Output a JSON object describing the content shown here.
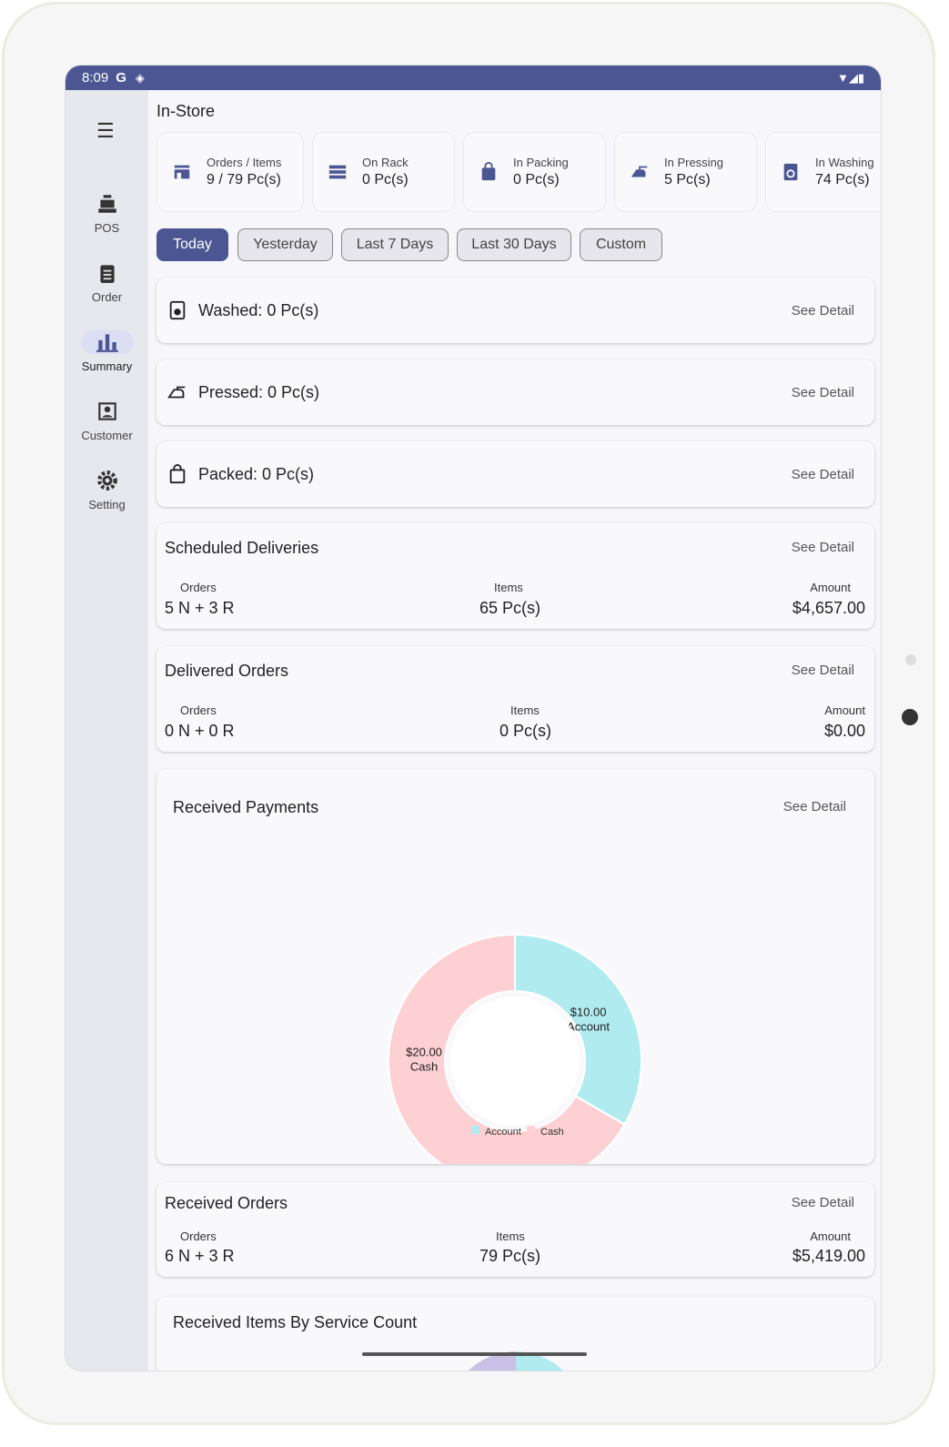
{
  "status": {
    "time": "8:09",
    "g": "G"
  },
  "sidebar": [
    {
      "label": "POS"
    },
    {
      "label": "Order"
    },
    {
      "label": "Summary"
    },
    {
      "label": "Customer"
    },
    {
      "label": "Setting"
    }
  ],
  "title": "In-Store",
  "stats": [
    {
      "label": "Orders / Items",
      "value": "9 / 79 Pc(s)"
    },
    {
      "label": "On Rack",
      "value": "0 Pc(s)"
    },
    {
      "label": "In Packing",
      "value": "0 Pc(s)"
    },
    {
      "label": "In Pressing",
      "value": "5 Pc(s)"
    },
    {
      "label": "In Washing",
      "value": "74 Pc(s)"
    }
  ],
  "filters": [
    "Today",
    "Yesterday",
    "Last 7 Days",
    "Last 30 Days",
    "Custom"
  ],
  "see_detail": "See Detail",
  "simple": [
    {
      "label": "Washed: 0 Pc(s)"
    },
    {
      "label": "Pressed: 0 Pc(s)"
    },
    {
      "label": "Packed: 0 Pc(s)"
    }
  ],
  "col": {
    "orders": "Orders",
    "items": "Items",
    "amount": "Amount"
  },
  "scheduled": {
    "title": "Scheduled Deliveries",
    "orders": "5 N + 3 R",
    "items": "65 Pc(s)",
    "amount": "$4,657.00"
  },
  "delivered": {
    "title": "Delivered Orders",
    "orders": "0 N + 0 R",
    "items": "0 Pc(s)",
    "amount": "$0.00"
  },
  "payments": {
    "title": "Received Payments"
  },
  "received": {
    "title": "Received Orders",
    "orders": "6 N + 3 R",
    "items": "79 Pc(s)",
    "amount": "$5,419.00"
  },
  "service": {
    "title": "Received Items By Service Count"
  },
  "chart_data": {
    "type": "pie",
    "title": "Received Payments",
    "labels": [
      "Account",
      "Cash"
    ],
    "values": [
      10,
      20
    ],
    "value_labels": [
      "$10.00",
      "$20.00"
    ],
    "colors": [
      "#b0ebef",
      "#fdd0d3"
    ],
    "legend": "bottom"
  }
}
